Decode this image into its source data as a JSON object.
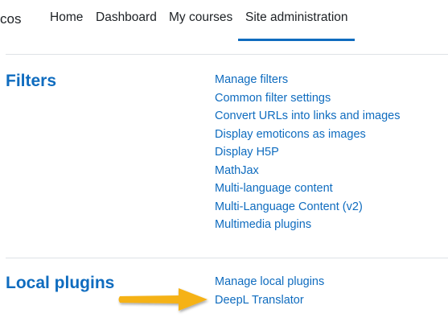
{
  "navbar": {
    "brand": "cos",
    "items": [
      {
        "label": "Home"
      },
      {
        "label": "Dashboard"
      },
      {
        "label": "My courses"
      },
      {
        "label": "Site administration",
        "active": true
      }
    ]
  },
  "sections": [
    {
      "title": "Filters",
      "links": [
        "Manage filters",
        "Common filter settings",
        "Convert URLs into links and images",
        "Display emoticons as images",
        "Display H5P",
        "MathJax",
        "Multi-language content",
        "Multi-Language Content (v2)",
        "Multimedia plugins"
      ]
    },
    {
      "title": "Local plugins",
      "links": [
        "Manage local plugins",
        "DeepL Translator"
      ]
    }
  ],
  "annotation": {
    "arrow_color": "#f5b217",
    "arrow_target": "DeepL Translator"
  },
  "colors": {
    "link": "#0f6cbf",
    "text": "#1d2125",
    "divider": "#dee2e6"
  }
}
